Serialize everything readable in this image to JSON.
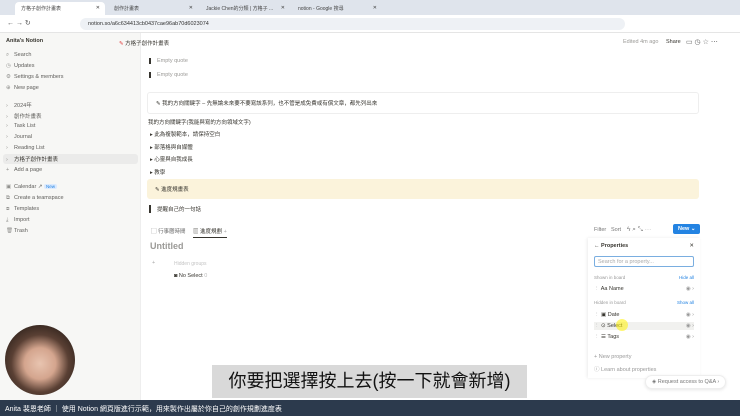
{
  "browser": {
    "tabs": [
      "方格子創作計畫表",
      "創作計畫表",
      "Jackie Chen的分類 | 方格子 ...",
      "notion - Google 搜尋"
    ],
    "url": "notion.so/a6c634413cb0437cae96ab70d6023074"
  },
  "topbar": {
    "breadcrumb": "方格子創作計畫表",
    "edited": "Edited 4m ago",
    "share": "Share"
  },
  "sidebar": {
    "workspace": "Anita's Notion",
    "items": [
      "Search",
      "Updates",
      "Settings & members",
      "New page"
    ],
    "pages": [
      "2024年",
      "創作計畫表",
      "Task List",
      "Journal",
      "Reading List",
      "方格子創作計畫表"
    ],
    "add_page": "Add a page",
    "bottom": [
      "Calendar ↗",
      "Create a teamspace",
      "Templates",
      "Import",
      "Trash"
    ],
    "new_badge": "New"
  },
  "content": {
    "empty_quote": "Empty quote",
    "callout1": "我的方向關鍵字 – 先無論未來要不要寫該系列，也不管是成免費或有償文章，都先列出來",
    "keyword_line": "我的方向關鍵字(我能與寫的方向領域文字)",
    "toggles": [
      "此為複製範本，請保持空白",
      "部落格與自媒體",
      "心靈與自我成長",
      "教學"
    ],
    "callout2": "進度規畫表",
    "quote": "提醒自己的一句話"
  },
  "database": {
    "views": [
      "行事曆時間",
      "進度規劃"
    ],
    "title": "Untitled",
    "hidden_groups": "Hidden groups",
    "group": "No Select",
    "group_count": "0",
    "filter": "Filter",
    "sort": "Sort",
    "new": "New"
  },
  "properties": {
    "title": "Properties",
    "search_placeholder": "Search for a property...",
    "shown": "Shown in board",
    "hide_all": "Hide all",
    "hidden": "Hidden in board",
    "show_all": "Show all",
    "shown_items": [
      "Name"
    ],
    "hidden_items": [
      "Date",
      "Select",
      "Tags"
    ],
    "new_property": "New property",
    "learn": "Learn about properties"
  },
  "qa": "Request access to Q&A",
  "subtitle": "你要把選擇按上去(按一下就會新增)",
  "banner": "Anita 裴恩老師 ｜ 使用 Notion 網頁版進行示範，用來製作出屬於你自己的創作規劃進度表"
}
